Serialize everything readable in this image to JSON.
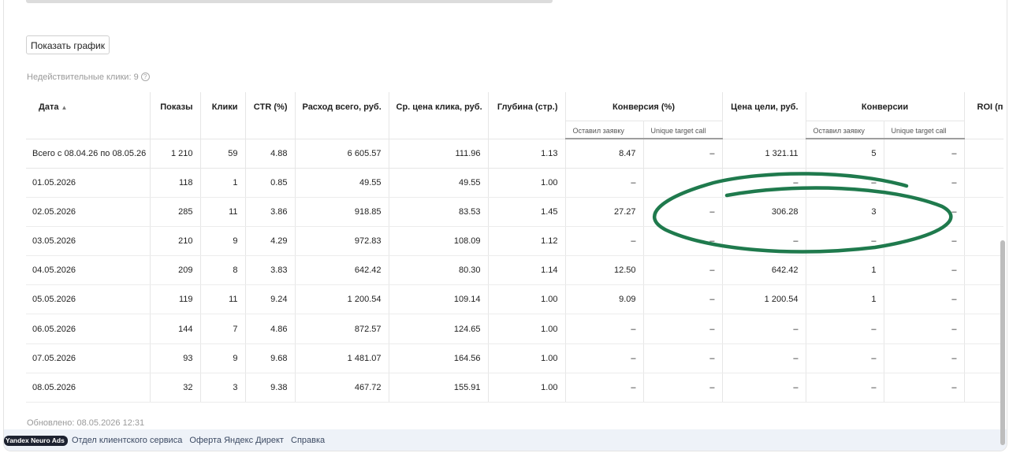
{
  "toolbar": {
    "show_chart_label": "Показать график"
  },
  "invalid_clicks": {
    "label": "Недействительные клики: 9",
    "help_icon": "?"
  },
  "totals": {
    "label": "Всего с 08.04.26 по 08.05.26",
    "values": [
      "1 210",
      "59",
      "4.88",
      "6 605.57",
      "111.96",
      "1.13",
      "8.47",
      "–",
      "1 321.11",
      "5",
      "–"
    ]
  },
  "columns": {
    "date": "Дата",
    "sort_indicator": "▲",
    "impressions": "Показы",
    "clicks": "Клики",
    "ctr": "CTR (%)",
    "spend": "Расход всего, руб.",
    "avg_cpc": "Ср. цена клика, руб.",
    "depth": "Глубина (стр.)",
    "conversion_rate": "Конверсия (%)",
    "goal_cost": "Цена цели, руб.",
    "conversions": "Конверсии",
    "roi": "ROI (по",
    "sub_left_request": "Оставил заявку",
    "sub_unique_call": "Unique target call"
  },
  "rows": [
    [
      "01.05.2026",
      "118",
      "1",
      "0.85",
      "49.55",
      "49.55",
      "1.00",
      "–",
      "–",
      "–",
      "–",
      "–"
    ],
    [
      "02.05.2026",
      "285",
      "11",
      "3.86",
      "918.85",
      "83.53",
      "1.45",
      "27.27",
      "–",
      "306.28",
      "3",
      "–"
    ],
    [
      "03.05.2026",
      "210",
      "9",
      "4.29",
      "972.83",
      "108.09",
      "1.12",
      "–",
      "–",
      "–",
      "–",
      "–"
    ],
    [
      "04.05.2026",
      "209",
      "8",
      "3.83",
      "642.42",
      "80.30",
      "1.14",
      "12.50",
      "–",
      "642.42",
      "1",
      "–"
    ],
    [
      "05.05.2026",
      "119",
      "11",
      "9.24",
      "1 200.54",
      "109.14",
      "1.00",
      "9.09",
      "–",
      "1 200.54",
      "1",
      "–"
    ],
    [
      "06.05.2026",
      "144",
      "7",
      "4.86",
      "872.57",
      "124.65",
      "1.00",
      "–",
      "–",
      "–",
      "–",
      "–"
    ],
    [
      "07.05.2026",
      "93",
      "9",
      "9.68",
      "1 481.07",
      "164.56",
      "1.00",
      "–",
      "–",
      "–",
      "–",
      "–"
    ],
    [
      "08.05.2026",
      "32",
      "3",
      "9.38",
      "467.72",
      "155.91",
      "1.00",
      "–",
      "–",
      "–",
      "–",
      "–"
    ]
  ],
  "updated": "Обновлено: 08.05.2026 12:31",
  "footer": {
    "logo": "Yandex Neuro Ads",
    "links": [
      "Отдел клиентского сервиса",
      "Оферта Яндекс Директ",
      "Справка"
    ]
  },
  "annotation": {
    "color": "#1f7a4d",
    "icon": "hand-drawn-ellipse"
  }
}
